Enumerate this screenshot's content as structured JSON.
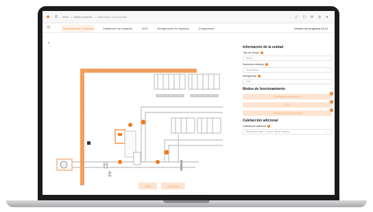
{
  "topbar": {
    "breadcrumbs": [
      "Inicio",
      "Editar proyecto",
      "Información de la unidad"
    ],
    "icons": [
      "expand-icon",
      "window-icon",
      "gear-icon",
      "help-icon",
      "user-icon"
    ]
  },
  "tabs": [
    {
      "label": "Información de la unidad",
      "active": true
    },
    {
      "label": "Calefacción de espacios",
      "active": false
    },
    {
      "label": "ACS",
      "active": false
    },
    {
      "label": "Refrigeración de espacios",
      "active": false
    },
    {
      "label": "Componente",
      "active": false
    }
  ],
  "version": "Versión del programa v3.10",
  "panel": {
    "unit_title": "Información de la unidad",
    "unit_type_label": "Tipo de unidad",
    "unit_type_value": "Mono",
    "power_label": "Suministro eléctrico",
    "power_value": "Monofásico",
    "refrigerant_label": "Refrigerante",
    "refrigerant_value": "R32",
    "modes_title": "Modos de funcionamiento",
    "mode_heating": "Calefacción de espacios",
    "mode_dhw": "ACS",
    "mode_cooling": "Refrigeración de espacios",
    "aux_title": "Calefacción adicional",
    "aux_label": "Calefacción adicional",
    "aux_value": "Bomba de calor + calent. eléctr. externo"
  },
  "actions": {
    "back": "Atrás",
    "next": "Siguiente"
  },
  "colors": {
    "accent": "#f07a1e",
    "accent_soft": "#fde4d0",
    "brick": "#f2a060",
    "pipe": "#c9c9c9"
  }
}
